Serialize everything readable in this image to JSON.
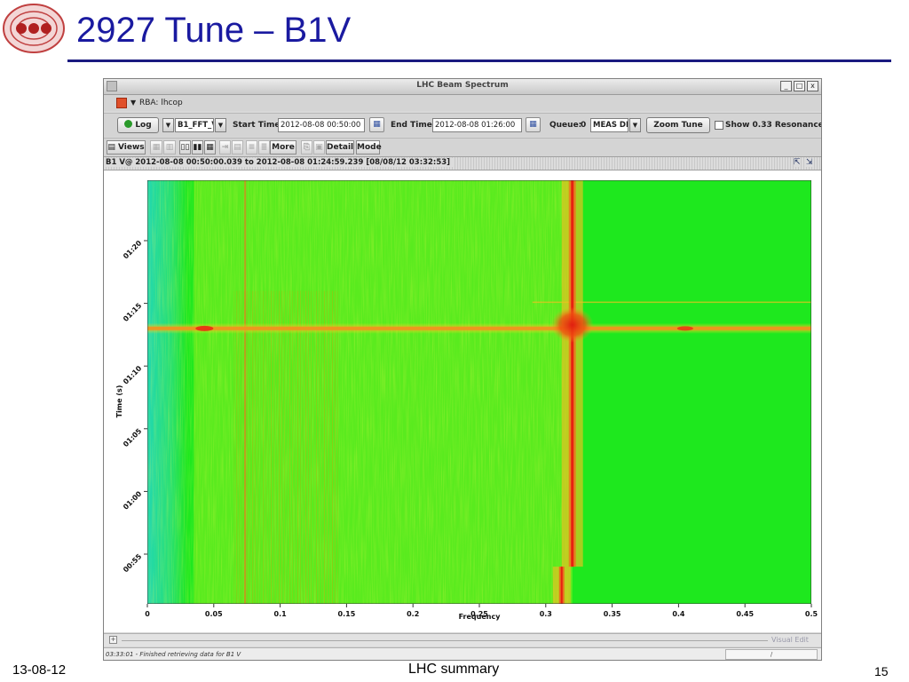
{
  "slide": {
    "title": "2927 Tune – B1V",
    "footer_date": "13-08-12",
    "footer_center": "LHC summary",
    "page_number": "15",
    "title_color": "#1a1aa0"
  },
  "window": {
    "title": "LHC Beam Spectrum",
    "controls": {
      "minimize": "_",
      "maximize": "□",
      "close": "x"
    }
  },
  "rba": {
    "icon": "rba-status-icon",
    "label": "RBA: lhcop"
  },
  "toolbar": {
    "log_button": "Log",
    "signal_select": "B1_FFT_V",
    "start_label": "Start Time:",
    "start_value": "2012-08-08 00:50:00",
    "end_label": "End Time:",
    "end_value": "2012-08-08 01:26:00",
    "queue_label": "Queue:",
    "queue_value": "0",
    "source_select": "MEAS DB",
    "zoom_button": "Zoom Tune",
    "resonance_label": "Show 0.33 Resonance"
  },
  "viewbar": {
    "views_button": "Views",
    "more_button": "More",
    "detail_button": "Detail",
    "mode_button": "Mode"
  },
  "plot_header": "B1 V@ 2012-08-08 00:50:00.039 to 2012-08-08 01:24:59.239  [08/08/12 03:32:53]",
  "chart_data": {
    "type": "heatmap",
    "xlabel": "Frequency",
    "ylabel": "Time (s)",
    "xlim": [
      0,
      0.5
    ],
    "x_ticks": [
      "0",
      "0.05",
      "0.1",
      "0.15",
      "0.2",
      "0.25",
      "0.3",
      "0.35",
      "0.4",
      "0.45",
      "0.5"
    ],
    "y_ticks": [
      "00:55",
      "01:00",
      "01:05",
      "01:10",
      "01:15",
      "01:20"
    ],
    "tune_line_frequency": 0.32,
    "tune_line_shift_frequency": 0.312,
    "tune_line_shift_time": "00:54",
    "excitation_time": "01:13",
    "colors": {
      "background": "#1ee81e",
      "low": "#20d8a0",
      "mid": "#c8f020",
      "high": "#e82010"
    }
  },
  "bottom_strip": {
    "label": "Visual Edit"
  },
  "status": {
    "message": "03:33:01 - Finished retrieving data for B1 V",
    "button": "/"
  }
}
